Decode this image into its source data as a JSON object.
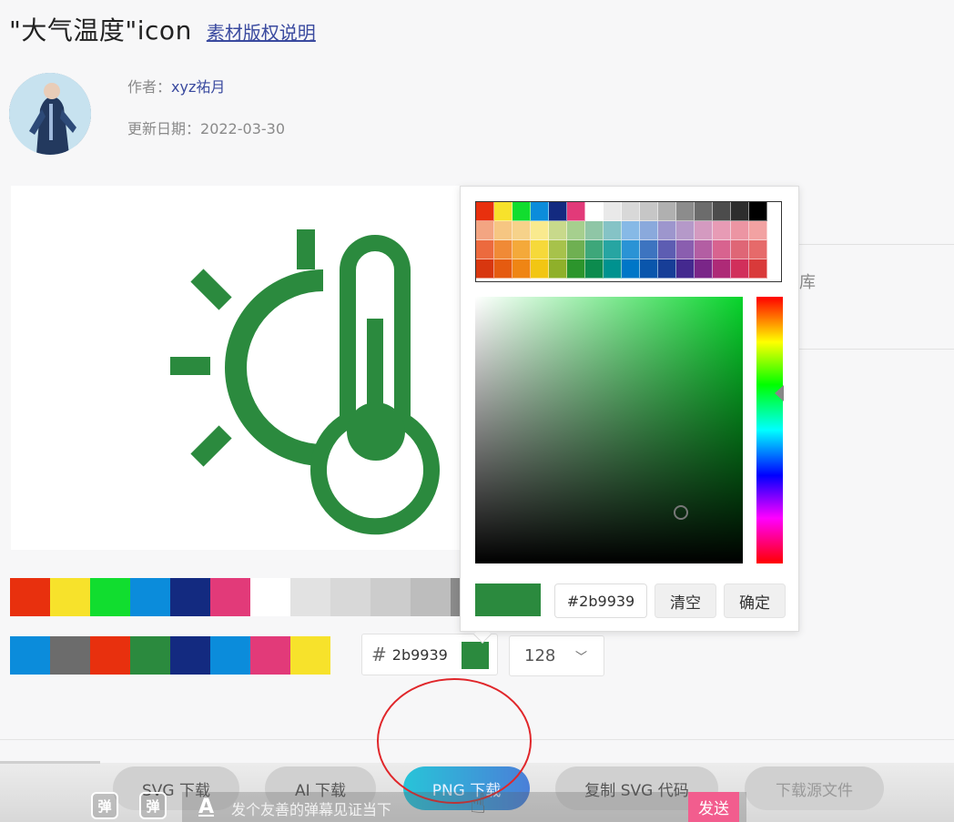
{
  "header": {
    "title": "\"大气温度\"icon",
    "copyright_link": "素材版权说明"
  },
  "author": {
    "label": "作者：",
    "name": "xyz祐月",
    "date_label": "更新日期：",
    "date": "2022-03-30"
  },
  "icon_color": "#2b8a3e",
  "right_panel": {
    "partial_text": "库"
  },
  "swatches_top": [
    "#e8300e",
    "#f7e22b",
    "#11dd2f",
    "#0b8cdb",
    "#132a80",
    "#e23a79",
    "#ffffff",
    "#e2e2e2",
    "#d8d8d8",
    "#cccccc",
    "#bdbdbd",
    "#8a8a8a"
  ],
  "swatches_bottom": [
    "#0b8cdb",
    "#6c6c6c",
    "#e8300e",
    "#2b8a3e",
    "#132a80",
    "#0b8cdb",
    "#e23a79",
    "#f7e22b"
  ],
  "color_input": {
    "hash": "#",
    "value": "2b9939"
  },
  "size_select": {
    "value": "128"
  },
  "picker": {
    "palette": [
      "#e8300e",
      "#f7e22b",
      "#11dd2f",
      "#0b8cdb",
      "#132a80",
      "#e23a79",
      "#ffffff",
      "#e9e9e9",
      "#d8d8d8",
      "#c6c6c6",
      "#b0b0b0",
      "#8c8c8c",
      "#6c6c6c",
      "#4c4c4c",
      "#2d2d2d",
      "#000000",
      "#f3a582",
      "#f6c682",
      "#f6d28a",
      "#f9ea8e",
      "#c8d98b",
      "#a6cf8e",
      "#8fc6a6",
      "#85c3c6",
      "#86b9e6",
      "#8aa9dc",
      "#9d96cd",
      "#b599c9",
      "#d49ac0",
      "#e79bb5",
      "#ec95a3",
      "#f2a2a2",
      "#ec6a3e",
      "#f08a36",
      "#f4a93a",
      "#f6d93a",
      "#a7c24b",
      "#6fb052",
      "#3ea77a",
      "#27a5a2",
      "#2a93d5",
      "#3d74c0",
      "#5d5db2",
      "#8a5eaf",
      "#b35ea3",
      "#d8638f",
      "#df6676",
      "#e66a6a",
      "#d8370f",
      "#e55b10",
      "#ef8514",
      "#f2c613",
      "#8fb02a",
      "#2c952c",
      "#0c8b4e",
      "#00928f",
      "#0076c7",
      "#0a56ac",
      "#173e97",
      "#44298f",
      "#7a2688",
      "#ae2a77",
      "#d12f5b",
      "#d93a3a"
    ],
    "hex_value": "#2b9939",
    "clear_label": "清空",
    "confirm_label": "确定"
  },
  "download": {
    "svg_label": "SVG 下载",
    "ai_label": "AI 下载",
    "png_label": "PNG 下载",
    "copy_svg_label": "复制 SVG 代码",
    "source_label": "下载源文件"
  },
  "danmaku": {
    "icon1": "弹",
    "icon2": "弹",
    "font_icon": "A",
    "placeholder": "发个友善的弹幕见证当下",
    "send_label": "发送"
  }
}
